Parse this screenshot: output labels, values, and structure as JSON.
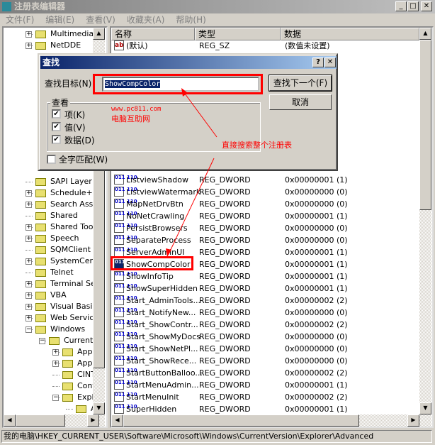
{
  "window": {
    "title": "注册表编辑器",
    "minimize": "_",
    "maximize": "□",
    "close": "✕"
  },
  "menu": [
    "文件(F)",
    "编辑(E)",
    "查看(V)",
    "收藏夹(A)",
    "帮助(H)"
  ],
  "tree": {
    "top_items": [
      {
        "label": "Multimedia",
        "expander": "+"
      },
      {
        "label": "NetDDE",
        "expander": "+"
      }
    ],
    "items": [
      {
        "label": "SAPI Layer",
        "expander": "",
        "level": 0
      },
      {
        "label": "Schedule+",
        "expander": "+",
        "level": 0
      },
      {
        "label": "Search Assis",
        "expander": "+",
        "level": 0
      },
      {
        "label": "Shared",
        "expander": "",
        "level": 0
      },
      {
        "label": "Shared Tools",
        "expander": "+",
        "level": 0
      },
      {
        "label": "Speech",
        "expander": "+",
        "level": 0
      },
      {
        "label": "SQMClient",
        "expander": "",
        "level": 0
      },
      {
        "label": "SystemCertif",
        "expander": "+",
        "level": 0
      },
      {
        "label": "Telnet",
        "expander": "",
        "level": 0
      },
      {
        "label": "Terminal Ser",
        "expander": "+",
        "level": 0
      },
      {
        "label": "VBA",
        "expander": "+",
        "level": 0
      },
      {
        "label": "Visual Basic",
        "expander": "+",
        "level": 0
      },
      {
        "label": "Web Service",
        "expander": "+",
        "level": 0
      },
      {
        "label": "Windows",
        "expander": "−",
        "level": 0
      },
      {
        "label": "CurrentV",
        "expander": "−",
        "level": 1
      },
      {
        "label": "App",
        "expander": "+",
        "level": 2
      },
      {
        "label": "Appl",
        "expander": "+",
        "level": 2
      },
      {
        "label": "CINT",
        "expander": "",
        "level": 2
      },
      {
        "label": "Cont",
        "expander": "",
        "level": 2
      },
      {
        "label": "Explo",
        "expander": "−",
        "level": 2
      },
      {
        "label": "A",
        "expander": "",
        "level": 3
      }
    ]
  },
  "list": {
    "columns": [
      "名称",
      "类型",
      "数据"
    ],
    "default_row": {
      "name": "(默认)",
      "type": "REG_SZ",
      "data": "(数值未设置)",
      "icon": "ab"
    },
    "rows": [
      {
        "name": "ListviewShadow",
        "type": "REG_DWORD",
        "data": "0x00000001 (1)"
      },
      {
        "name": "ListviewWatermark",
        "type": "REG_DWORD",
        "data": "0x00000000 (0)"
      },
      {
        "name": "MapNetDrvBtn",
        "type": "REG_DWORD",
        "data": "0x00000000 (0)"
      },
      {
        "name": "NoNetCrawling",
        "type": "REG_DWORD",
        "data": "0x00000001 (1)"
      },
      {
        "name": "PersistBrowsers",
        "type": "REG_DWORD",
        "data": "0x00000000 (0)"
      },
      {
        "name": "SeparateProcess",
        "type": "REG_DWORD",
        "data": "0x00000000 (0)"
      },
      {
        "name": "ServerAdminUI",
        "type": "REG_DWORD",
        "data": "0x00000001 (1)"
      },
      {
        "name": "ShowCompColor",
        "type": "REG_DWORD",
        "data": "0x00000001 (1)",
        "selected": true
      },
      {
        "name": "ShowInfoTip",
        "type": "REG_DWORD",
        "data": "0x00000001 (1)"
      },
      {
        "name": "ShowSuperHidden",
        "type": "REG_DWORD",
        "data": "0x00000001 (1)"
      },
      {
        "name": "Start_AdminTools...",
        "type": "REG_DWORD",
        "data": "0x00000002 (2)"
      },
      {
        "name": "Start_NotifyNew...",
        "type": "REG_DWORD",
        "data": "0x00000000 (0)"
      },
      {
        "name": "Start_ShowContr...",
        "type": "REG_DWORD",
        "data": "0x00000002 (2)"
      },
      {
        "name": "Start_ShowMyDocs",
        "type": "REG_DWORD",
        "data": "0x00000000 (0)"
      },
      {
        "name": "Start_ShowNetPl...",
        "type": "REG_DWORD",
        "data": "0x00000000 (0)"
      },
      {
        "name": "Start_ShowRece...",
        "type": "REG_DWORD",
        "data": "0x00000000 (0)"
      },
      {
        "name": "StartButtonBalloo...",
        "type": "REG_DWORD",
        "data": "0x00000002 (2)"
      },
      {
        "name": "StartMenuAdmin...",
        "type": "REG_DWORD",
        "data": "0x00000001 (1)"
      },
      {
        "name": "StartMenuInit",
        "type": "REG_DWORD",
        "data": "0x00000002 (2)"
      },
      {
        "name": "SuperHidden",
        "type": "REG_DWORD",
        "data": "0x00000001 (1)"
      }
    ]
  },
  "status": "我的电脑\\HKEY_CURRENT_USER\\Software\\Microsoft\\Windows\\CurrentVersion\\Explorer\\Advanced",
  "find_dialog": {
    "title": "查找",
    "help": "?",
    "close": "✕",
    "target_label": "查找目标(N)",
    "target_value": "ShowCompColor",
    "find_next": "查找下一个(F)",
    "cancel": "取消",
    "look_at": "查看",
    "options": [
      {
        "label": "项(K)",
        "checked": true
      },
      {
        "label": "值(V)",
        "checked": true
      },
      {
        "label": "数据(D)",
        "checked": true
      }
    ],
    "whole_match": {
      "label": "全字匹配(W)",
      "checked": false
    }
  },
  "annotations": {
    "watermark_url": "www.pc811.com",
    "watermark_name": "电脑互助网",
    "note": "直接搜索整个注册表",
    "color": "#ff0000"
  }
}
